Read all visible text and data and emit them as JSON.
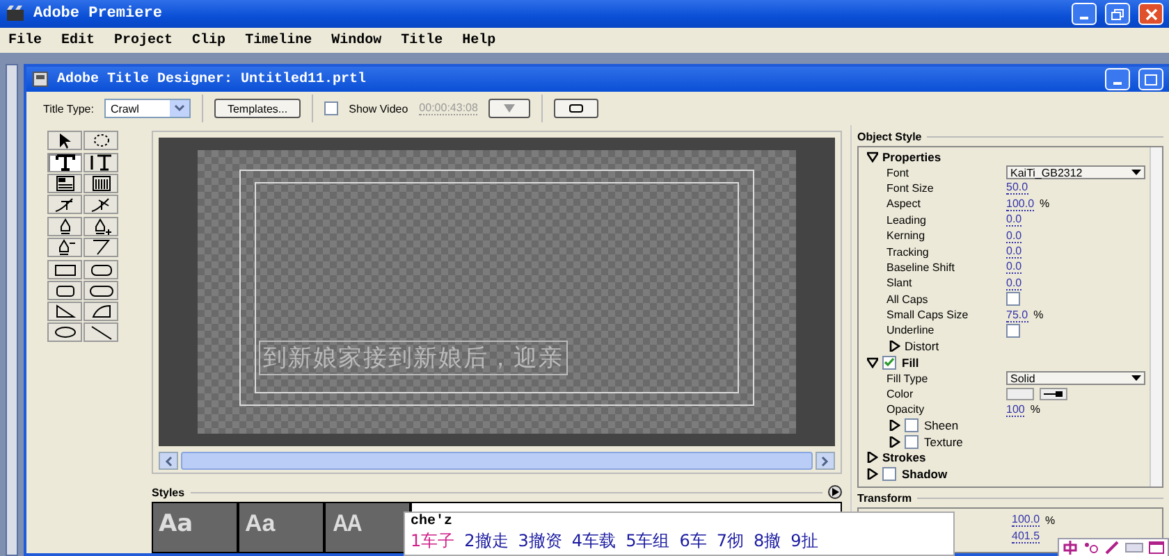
{
  "app": {
    "title": "Adobe Premiere"
  },
  "menu": [
    "File",
    "Edit",
    "Project",
    "Clip",
    "Timeline",
    "Window",
    "Title",
    "Help"
  ],
  "designer": {
    "title": "Adobe Title Designer: Untitled11.prtl"
  },
  "toolbar": {
    "title_type_label": "Title Type:",
    "title_type": "Crawl",
    "templates_button": "Templates...",
    "show_video": {
      "label": "Show Video",
      "checked": false
    },
    "timecode": "00:00:43:08"
  },
  "tools": [
    {
      "kind": "select",
      "selected": false
    },
    {
      "kind": "rotate",
      "selected": false
    },
    {
      "kind": "type",
      "selected": true
    },
    {
      "kind": "vtype",
      "selected": false
    },
    {
      "kind": "areatype",
      "selected": false
    },
    {
      "kind": "vareatype",
      "selected": false
    },
    {
      "kind": "pathtype",
      "selected": false
    },
    {
      "kind": "vpathtype",
      "selected": false
    },
    {
      "kind": "pen",
      "selected": false
    },
    {
      "kind": "penadd",
      "selected": false
    },
    {
      "kind": "pendel",
      "selected": false
    },
    {
      "kind": "convert",
      "selected": false
    },
    {
      "kind": "rect",
      "selected": false
    },
    {
      "kind": "roundrect",
      "selected": false
    },
    {
      "kind": "clipped",
      "selected": false
    },
    {
      "kind": "pill",
      "selected": false
    },
    {
      "kind": "wedge",
      "selected": false
    },
    {
      "kind": "arc",
      "selected": false
    },
    {
      "kind": "ellipse",
      "selected": false
    },
    {
      "kind": "line",
      "selected": false
    }
  ],
  "canvas": {
    "text": "到新娘家接到新娘后，迎亲"
  },
  "styles": {
    "title": "Styles",
    "swatches": [
      {
        "label": "Aa",
        "kind": "serif"
      },
      {
        "label": "Aa",
        "kind": "sans"
      },
      {
        "label": "AA",
        "kind": "bold"
      }
    ]
  },
  "object_style": {
    "title": "Object Style",
    "sections": [
      {
        "label": "Properties",
        "kind": "plain",
        "expanded": true,
        "rows": [
          {
            "kind": "dropdown",
            "label": "Font",
            "value": "KaiTi_GB2312"
          },
          {
            "kind": "number",
            "label": "Font Size",
            "value": "50.0"
          },
          {
            "kind": "number",
            "label": "Aspect",
            "value": "100.0",
            "unit": "%"
          },
          {
            "kind": "number",
            "label": "Leading",
            "value": "0.0"
          },
          {
            "kind": "number",
            "label": "Kerning",
            "value": "0.0"
          },
          {
            "kind": "number",
            "label": "Tracking",
            "value": "0.0"
          },
          {
            "kind": "number",
            "label": "Baseline Shift",
            "value": "0.0"
          },
          {
            "kind": "number",
            "label": "Slant",
            "value": "0.0"
          },
          {
            "kind": "checkbox",
            "label": "All Caps",
            "checked": false
          },
          {
            "kind": "number",
            "label": "Small Caps Size",
            "value": "75.0",
            "unit": "%"
          },
          {
            "kind": "checkbox",
            "label": "Underline",
            "checked": false
          },
          {
            "kind": "expander",
            "label": "Distort",
            "expanded": false
          }
        ]
      },
      {
        "label": "Fill",
        "kind": "checkable",
        "checked": true,
        "expanded": true,
        "rows": [
          {
            "kind": "dropdown",
            "label": "Fill Type",
            "value": "Solid"
          },
          {
            "kind": "color",
            "label": "Color"
          },
          {
            "kind": "number",
            "label": "Opacity",
            "value": "100",
            "unit": "%"
          },
          {
            "kind": "check_expander",
            "label": "Sheen",
            "checked": false,
            "expanded": false
          },
          {
            "kind": "check_expander",
            "label": "Texture",
            "checked": false,
            "expanded": false
          }
        ]
      },
      {
        "label": "Strokes",
        "kind": "plain",
        "expanded": false
      },
      {
        "label": "Shadow",
        "kind": "checkable",
        "checked": false,
        "expanded": false
      }
    ]
  },
  "transform": {
    "title": "Transform",
    "rows": [
      {
        "value": "100.0",
        "unit": "%"
      },
      {
        "value": "401.5"
      }
    ]
  },
  "ime": {
    "composition": "che'z",
    "candidates": [
      {
        "label": "1车子",
        "selected": true
      },
      {
        "label": "2撤走",
        "selected": false
      },
      {
        "label": "3撤资",
        "selected": false
      },
      {
        "label": "4车载",
        "selected": false
      },
      {
        "label": "5车组",
        "selected": false
      },
      {
        "label": "6车",
        "selected": false
      },
      {
        "label": "7彻",
        "selected": false
      },
      {
        "label": "8撤",
        "selected": false
      },
      {
        "label": "9扯",
        "selected": false
      }
    ]
  }
}
